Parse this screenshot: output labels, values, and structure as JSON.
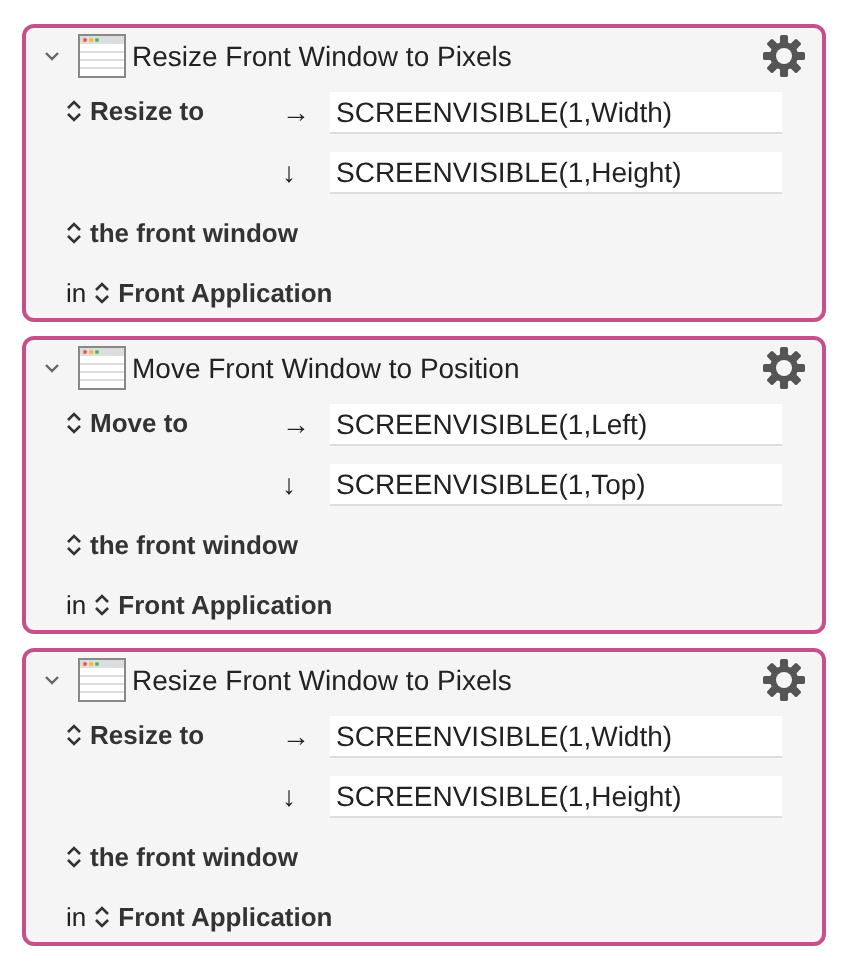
{
  "actions": [
    {
      "title": "Resize Front Window to Pixels",
      "expanded": true,
      "mode": "Resize to",
      "fields": [
        {
          "arrow": "→",
          "value": "SCREENVISIBLE(1,Width)"
        },
        {
          "arrow": "↓",
          "value": "SCREENVISIBLE(1,Height)"
        }
      ],
      "target": "the front window",
      "prefix": "in",
      "app": "Front Application"
    },
    {
      "title": "Move Front Window to Position",
      "expanded": true,
      "mode": "Move to",
      "fields": [
        {
          "arrow": "→",
          "value": "SCREENVISIBLE(1,Left)"
        },
        {
          "arrow": "↓",
          "value": "SCREENVISIBLE(1,Top)"
        }
      ],
      "target": "the front window",
      "prefix": "in",
      "app": "Front Application"
    },
    {
      "title": "Resize Front Window to Pixels",
      "expanded": true,
      "mode": "Resize to",
      "fields": [
        {
          "arrow": "→",
          "value": "SCREENVISIBLE(1,Width)"
        },
        {
          "arrow": "↓",
          "value": "SCREENVISIBLE(1,Height)"
        }
      ],
      "target": "the front window",
      "prefix": "in",
      "app": "Front Application"
    }
  ]
}
